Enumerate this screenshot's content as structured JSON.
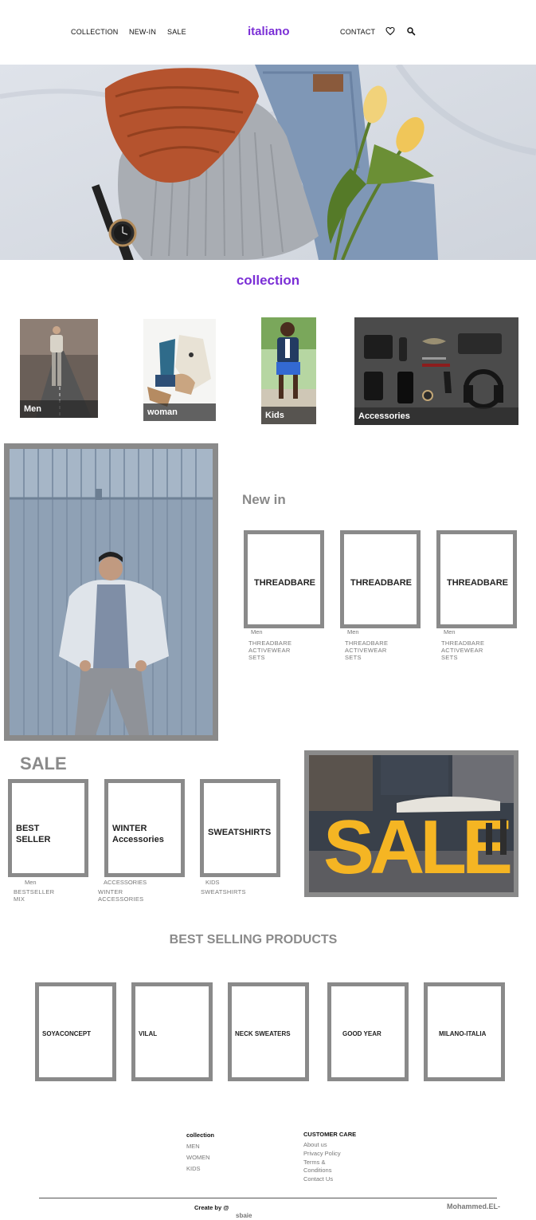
{
  "nav": {
    "left_links": [
      "COLLECTION",
      "NEW-IN",
      "SALE"
    ],
    "brand": "italiano",
    "contact": "CONTACT",
    "icons": [
      "heart-icon",
      "search-icon"
    ]
  },
  "colors": {
    "accent": "#7b2fd6",
    "frame_gray": "#8a8a8a"
  },
  "collection": {
    "title": "collection",
    "items": [
      {
        "label": "Men"
      },
      {
        "label": "woman"
      },
      {
        "label": "Kids"
      },
      {
        "label": "Accessories"
      }
    ]
  },
  "new_in": {
    "title": "New in",
    "cards": [
      {
        "name": "THREADBARE",
        "category": "Men",
        "desc": [
          "THREADBARE",
          "ACTIVEWEAR",
          "SETS"
        ]
      },
      {
        "name": "THREADBARE",
        "category": "Men",
        "desc": [
          "THREADBARE",
          "ACTIVEWEAR",
          "SETS"
        ]
      },
      {
        "name": "THREADBARE",
        "category": "Men",
        "desc": [
          "THREADBARE",
          "ACTIVEWEAR",
          "SETS"
        ]
      }
    ]
  },
  "sale": {
    "title": "SALE",
    "cards": [
      {
        "name": [
          "BEST",
          "SELLER"
        ],
        "category": "Men",
        "desc": [
          "BESTSELLER",
          "MIX"
        ]
      },
      {
        "name": [
          "WINTER",
          "Accessories"
        ],
        "category": "ACCESSORIES",
        "desc": [
          "WINTER",
          "ACCESSORIES"
        ]
      },
      {
        "name": [
          "SWEATSHIRTS"
        ],
        "category": "KIDS",
        "desc": [
          "SWEATSHIRTS"
        ]
      }
    ],
    "banner_text": "SALE"
  },
  "best_selling": {
    "title": "BEST SELLING PRODUCTS",
    "items": [
      "SOYACONCEPT",
      "VILAL",
      "NECK SWEATERS",
      "GOOD YEAR",
      "MILANO-ITALIA"
    ]
  },
  "footer": {
    "collection_title": "collection",
    "collection_links": [
      "MEN",
      "WOMEN",
      "KIDS"
    ],
    "care_title": "CUSTOMER CARE",
    "care_links": [
      "About us",
      "Privacy Policy",
      "Terms &",
      "Conditions",
      "Contact Us"
    ],
    "credit_prefix": "Create by @",
    "credit_handle": "sbaie",
    "author": "Mohammed.EL-"
  }
}
